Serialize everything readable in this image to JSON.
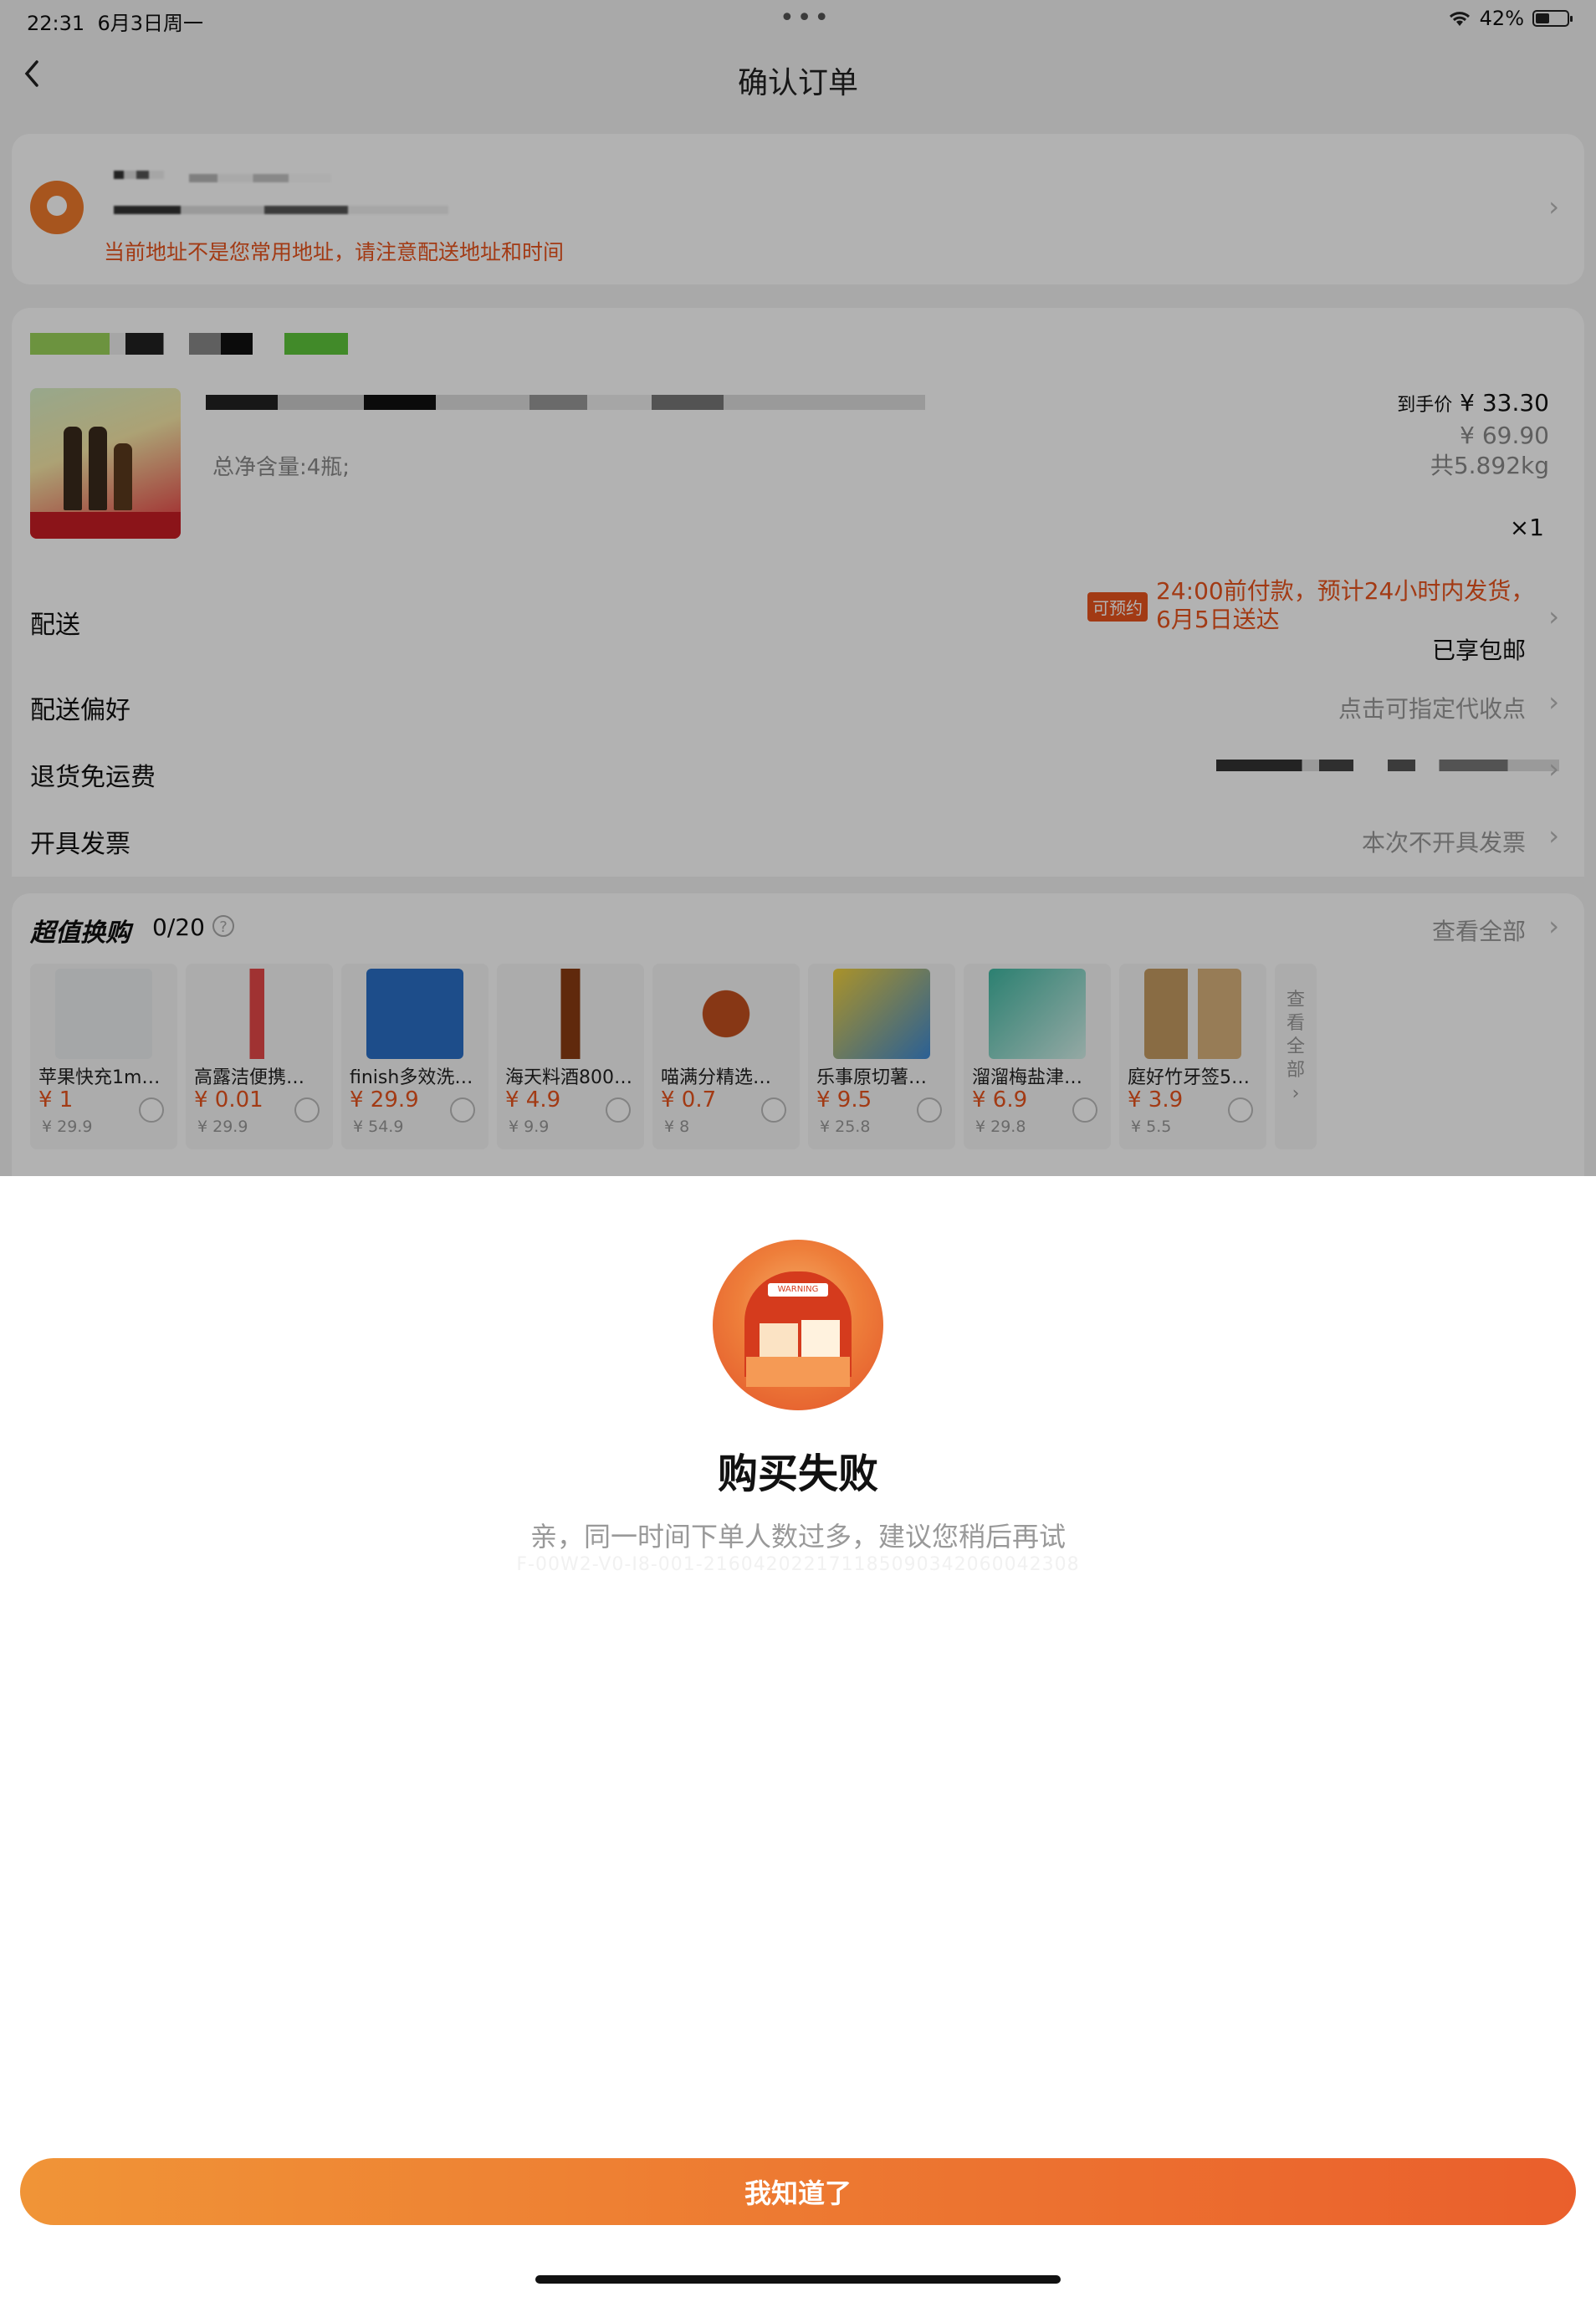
{
  "status_bar": {
    "time": "22:31",
    "date": "6月3日周一",
    "battery": "42%"
  },
  "nav": {
    "title": "确认订单",
    "back_icon": "chevron-left-icon"
  },
  "address": {
    "warning": "当前地址不是您常用地址，请注意配送地址和时间"
  },
  "product": {
    "spec": "总净含量:4瓶;",
    "final_price_label": "到手价",
    "final_price": "¥ 33.30",
    "original_price": "¥ 69.90",
    "weight": "共5.892kg",
    "quantity": "×1"
  },
  "delivery": {
    "label": "配送",
    "badge": "可预约",
    "info_line1": "24:00前付款，预计24小时内发货，",
    "info_line2": "6月5日送达",
    "shipping": "已享包邮"
  },
  "preference": {
    "label": "配送偏好",
    "value": "点击可指定代收点"
  },
  "return_shipping": {
    "label": "退货免运费"
  },
  "invoice": {
    "label": "开具发票",
    "value": "本次不开具发票"
  },
  "swap": {
    "title": "超值换购",
    "count": "0/20",
    "view_all": "查看全部",
    "more_label": "查看全部",
    "items": [
      {
        "name": "苹果快充1m…",
        "price": "¥ 1",
        "original": "¥ 29.9"
      },
      {
        "name": "高露洁便携…",
        "price": "¥ 0.01",
        "original": "¥ 29.9"
      },
      {
        "name": "finish多效洗…",
        "price": "¥ 29.9",
        "original": "¥ 54.9"
      },
      {
        "name": "海天料酒800…",
        "price": "¥ 4.9",
        "original": "¥ 9.9"
      },
      {
        "name": "喵满分精选…",
        "price": "¥ 0.7",
        "original": "¥ 8"
      },
      {
        "name": "乐事原切薯…",
        "price": "¥ 9.5",
        "original": "¥ 25.8"
      },
      {
        "name": "溜溜梅盐津…",
        "price": "¥ 6.9",
        "original": "¥ 29.8"
      },
      {
        "name": "庭好竹牙签5…",
        "price": "¥ 3.9",
        "original": "¥ 5.5"
      }
    ]
  },
  "dialog": {
    "title": "购买失败",
    "message": "亲，同一时间下单人数过多，建议您稍后再试",
    "trace": "F-00W2-V0-I8-001-216042022171185090342060042308",
    "button": "我知道了",
    "icon_warning_text": "WARNING"
  },
  "colors": {
    "accent": "#e8541e",
    "button_start": "#f09437",
    "button_end": "#ea5f2c"
  }
}
